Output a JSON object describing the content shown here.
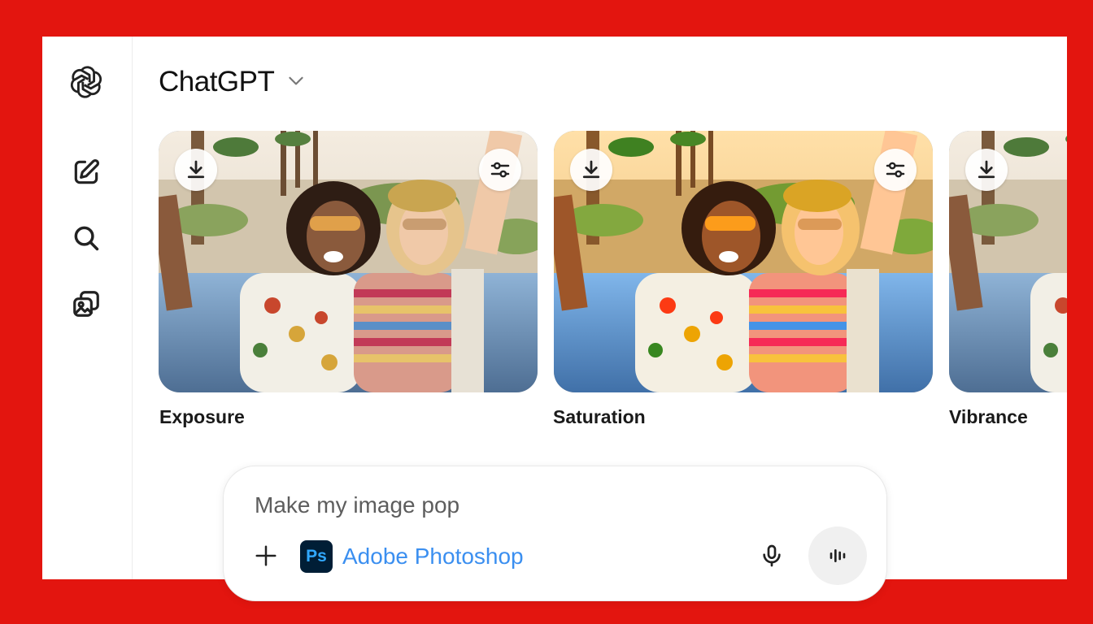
{
  "header": {
    "model_name": "ChatGPT"
  },
  "sidebar": {
    "items": [
      {
        "name": "openai-logo-icon"
      },
      {
        "name": "new-chat-icon"
      },
      {
        "name": "search-icon"
      },
      {
        "name": "images-icon"
      }
    ]
  },
  "cards": [
    {
      "label": "Exposure",
      "tone": "natural"
    },
    {
      "label": "Saturation",
      "tone": "warm"
    },
    {
      "label": "Vibrance",
      "tone": "natural"
    }
  ],
  "composer": {
    "prompt_text": "Make my image pop",
    "tool_name": "Adobe Photoshop",
    "tool_icon_text": "Ps"
  },
  "colors": {
    "background": "#e3150f",
    "tool_link": "#3b8ff0",
    "photoshop_bg": "#001e36",
    "photoshop_fg": "#31a8ff"
  }
}
